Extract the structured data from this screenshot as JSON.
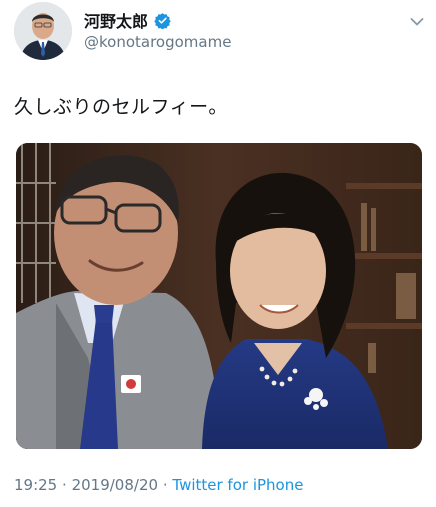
{
  "author": {
    "display_name": "河野太郎",
    "handle": "@konotarogomame",
    "verified": true
  },
  "tweet": {
    "text": "久しぶりのセルフィー。",
    "time": "19:25",
    "separator": "·",
    "date": "2019/08/20",
    "source": "Twitter for iPhone"
  },
  "icons": {
    "verified": "verified-badge-icon",
    "menu": "chevron-down-icon"
  },
  "colors": {
    "accent": "#1b95e0",
    "text": "#14171a",
    "secondary": "#657786"
  }
}
